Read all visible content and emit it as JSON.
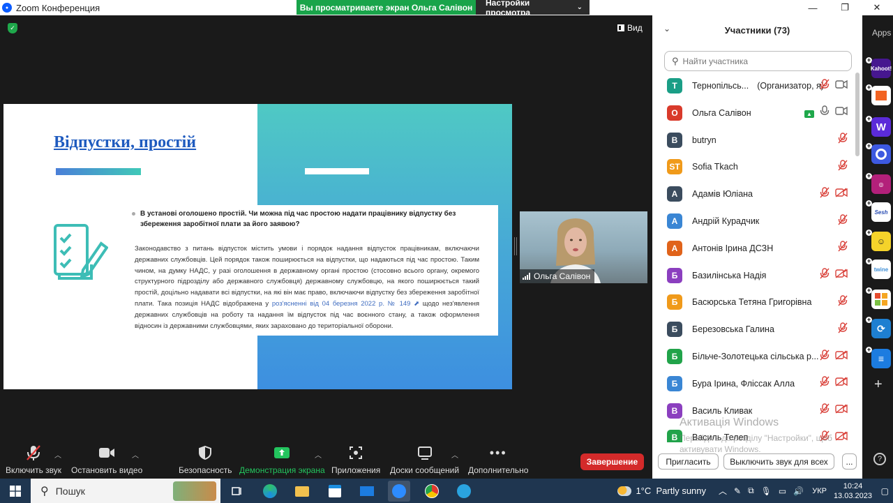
{
  "window": {
    "title": "Zoom Конференция"
  },
  "share_banner": {
    "viewing_text": "Вы просматриваете экран Ольга Салівон",
    "settings_label": "Настройки просмотра"
  },
  "meeting": {
    "view_label": "Вид"
  },
  "slide": {
    "title": "Відпустки, простій",
    "question": "В установі оголошено простій. Чи можна під час простою надати працівнику відпустку без збереження заробітної плати за його заявою?",
    "body_part1": "Законодавство з питань відпусток містить умови і порядок надання відпусток працівникам, включаючи державних службовців. Цей порядок також поширюється на відпустки, що надаються під час простою. Таким чином, на думку НАДС, у разі оголошення в державному органі простою (стосовно всього органу, окремого структурного підрозділу або державного службовця) державному службовцю, на якого поширюється такий простій, доцільно надавати всі відпустки, на які він має право, включаючи відпустку без збереження заробітної плати. Така позиція НАДС відображена у ",
    "body_link": "роз'ясненні від 04 березня 2022 р. № 149",
    "body_part2": " щодо нез'явлення державних службовців на роботу та надання їм відпусток під час воєнного стану, а також оформлення відносин із державними службовцями, яких зараховано до територіальної оборони."
  },
  "video_tile": {
    "name": "Ольга Салівон"
  },
  "toolbar": {
    "mute": "Включить звук",
    "video": "Остановить видео",
    "security": "Безопасность",
    "share": "Демонстрация экрана",
    "apps": "Приложения",
    "whiteboard": "Доски сообщений",
    "more": "Дополнительно",
    "end": "Завершение"
  },
  "participants": {
    "header": "Участники (73)",
    "search_placeholder": "Найти участника",
    "list": [
      {
        "initials": "T",
        "name": "Тернопільсь...",
        "role": "(Организатор, я)",
        "color": "#1a9e86"
      },
      {
        "initials": "О",
        "name": "Ольга Салівон",
        "role": "",
        "color": "#d93a2b"
      },
      {
        "initials": "B",
        "name": "butryn",
        "role": "",
        "color": "#3b4c5e"
      },
      {
        "initials": "ST",
        "name": "Sofia Tkach",
        "role": "",
        "color": "#f09a1a"
      },
      {
        "initials": "А",
        "name": "Адамів Юліана",
        "role": "",
        "color": "#3b4c5e"
      },
      {
        "initials": "А",
        "name": "Андрій Курадчик",
        "role": "",
        "color": "#3a86d4"
      },
      {
        "initials": "А",
        "name": "Антонів Ірина ДСЗН",
        "role": "",
        "color": "#e0631a"
      },
      {
        "initials": "Б",
        "name": "Базилінська Надія",
        "role": "",
        "color": "#8b3fbf"
      },
      {
        "initials": "Б",
        "name": "Басюрська Тетяна Григорівна",
        "role": "",
        "color": "#f09a1a"
      },
      {
        "initials": "Б",
        "name": "Березовська Галина",
        "role": "",
        "color": "#3b4c5e"
      },
      {
        "initials": "Б",
        "name": "Більче-Золотецька сільська р...",
        "role": "",
        "color": "#21a34a"
      },
      {
        "initials": "Б",
        "name": "Бура Ірина, Флiссак Алла",
        "role": "",
        "color": "#3a86d4"
      },
      {
        "initials": "В",
        "name": "Василь Кливак",
        "role": "",
        "color": "#8b3fbf"
      },
      {
        "initials": "В",
        "name": "Василь Телеп",
        "role": "",
        "color": "#21a34a"
      }
    ],
    "watermark_title": "Активація Windows",
    "watermark_text": "Перейдіть до розділу \"Настройки\", щоб активувати Windows.",
    "invite_label": "Пригласить",
    "mute_all_label": "Выключить звук для всех",
    "more_label": "..."
  },
  "apps_strip": {
    "label": "Apps",
    "items": [
      "Kahoot!",
      "Sesh",
      "twine"
    ]
  },
  "taskbar": {
    "search_label": "Пошук",
    "weather": "1°C  Partly sunny",
    "lang": "УКР",
    "time": "10:24",
    "date": "13.03.2023"
  }
}
